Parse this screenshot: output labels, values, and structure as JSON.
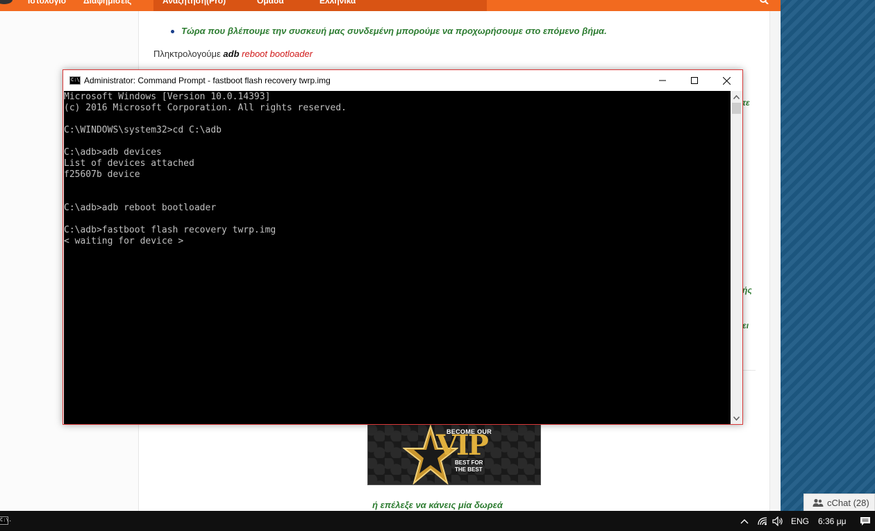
{
  "browser": {
    "nav": {
      "item_1": "Ιστολόγιο",
      "item_2": "Διαφημίσεις",
      "item_3": "Αναζήτηση(Pro)",
      "item_4": "Ομάδα",
      "item_5": "Ελληνικά"
    },
    "article": {
      "bullet": "Τώρα που βλέπουμε την συσκευή μας συνδεμένη μπορούμε να προχωρήσουμε στο επόμενο βήμα.",
      "type_prefix": "Πληκτρολογούμε ",
      "type_cmd_1": "adb",
      "type_cmd_2": "reboot bootloader",
      "clipped_1": "τε",
      "clipped_2": "ής",
      "clipped_3": "ει",
      "donate": "ή επέλεξε να κάνεις μία δωρεά"
    },
    "vip_banner": {
      "become": "BECOME OUR",
      "vip": "VIP",
      "best_1": "BEST FOR",
      "best_2": "THE BEST"
    }
  },
  "cmd": {
    "title": "Administrator: Command Prompt - fastboot  flash recovery twrp.img",
    "app_icon_text": "C:\\.",
    "lines": [
      "Microsoft Windows [Version 10.0.14393]",
      "(c) 2016 Microsoft Corporation. All rights reserved.",
      "",
      "C:\\WINDOWS\\system32>cd C:\\adb",
      "",
      "C:\\adb>adb devices",
      "List of devices attached",
      "f25607b device",
      "",
      "",
      "C:\\adb>adb reboot bootloader",
      "",
      "C:\\adb>fastboot flash recovery twrp.img",
      "< waiting for device >"
    ]
  },
  "chat": {
    "label": "cChat (28)"
  },
  "taskbar": {
    "language": "ENG",
    "time": "6:36 μμ",
    "task_icon_text": "C:\\."
  },
  "colors": {
    "orange_nav": "#f26a1f",
    "green_text": "#2e7d32",
    "red_text": "#d01818",
    "blue_panel": "#1d5a85",
    "console_bg": "#000000",
    "console_text": "#c0c0c0"
  }
}
